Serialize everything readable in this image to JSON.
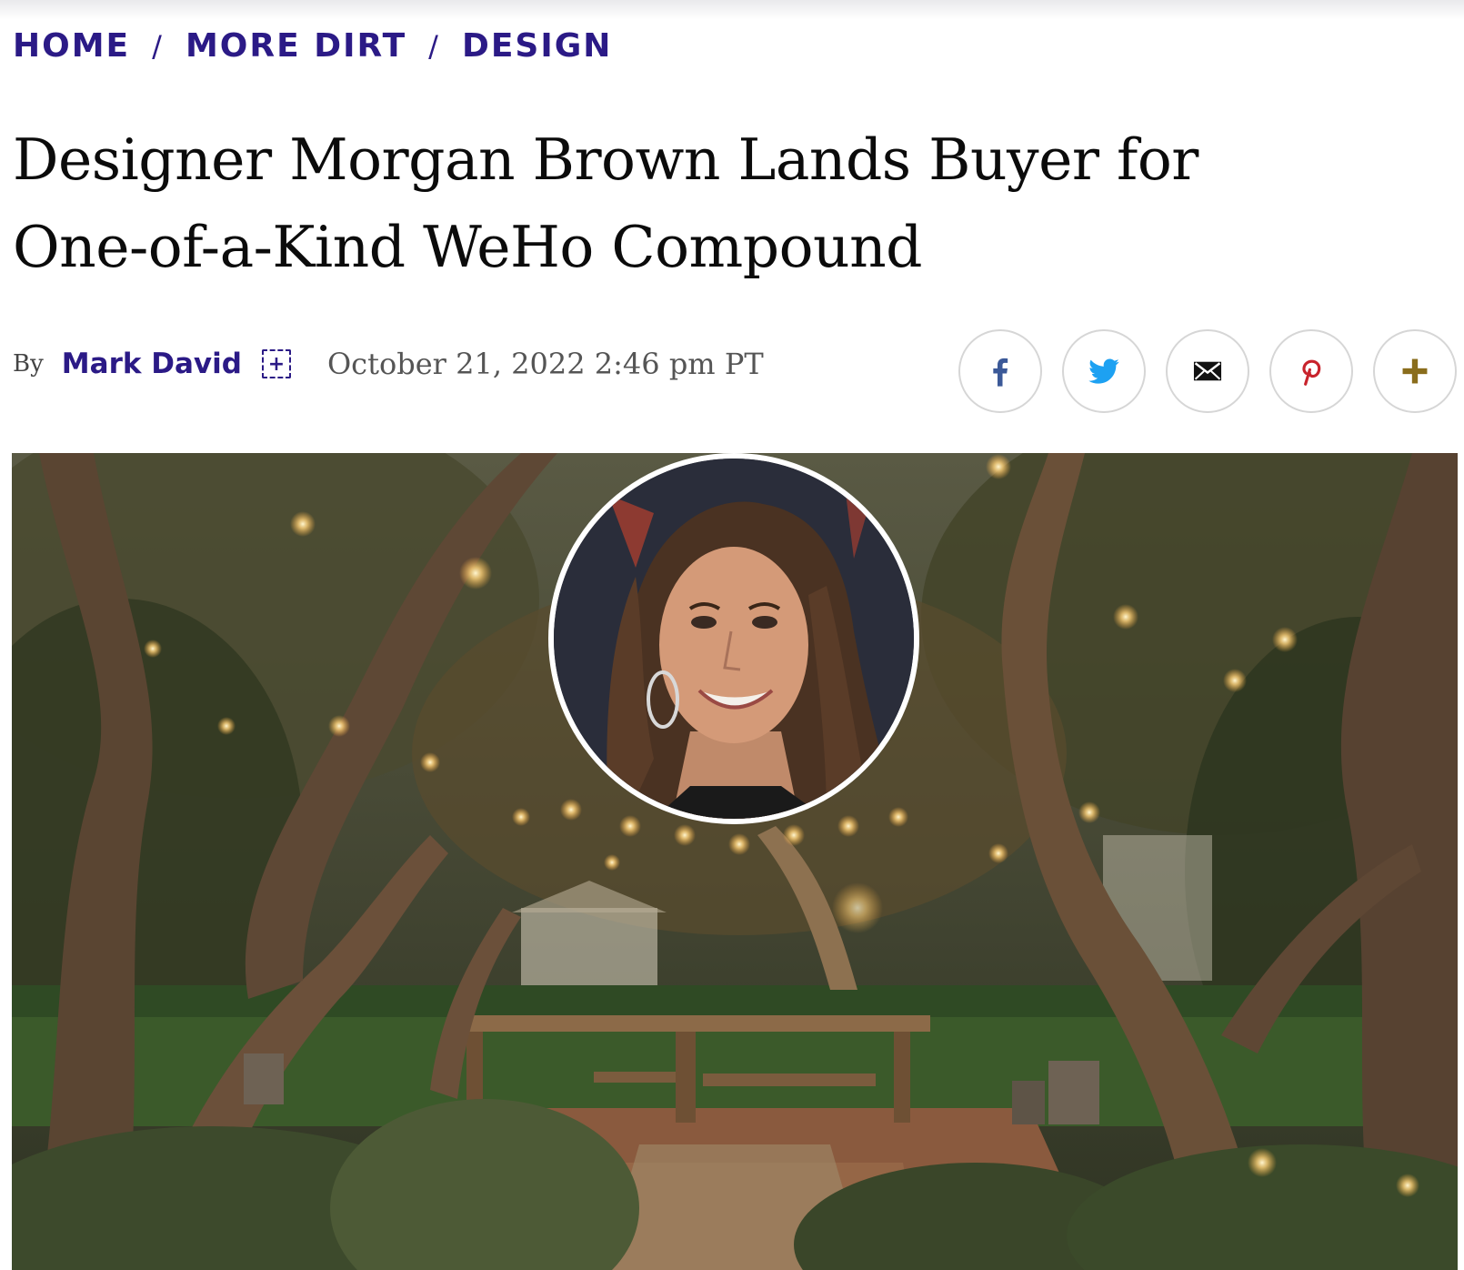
{
  "breadcrumb": {
    "items": [
      {
        "label": "HOME"
      },
      {
        "label": "MORE DIRT"
      },
      {
        "label": "DESIGN"
      }
    ],
    "separator": "/"
  },
  "article": {
    "title_line1": "Designer Morgan Brown Lands Buyer for",
    "title_line2": "One-of-a-Kind WeHo Compound",
    "by_label": "By",
    "author": "Mark David",
    "date": "October 21, 2022 2:46 pm PT"
  },
  "share": {
    "buttons": [
      {
        "icon": "facebook-icon",
        "color": "#3b5998"
      },
      {
        "icon": "twitter-icon",
        "color": "#1da1f2"
      },
      {
        "icon": "email-icon",
        "color": "#111111"
      },
      {
        "icon": "pinterest-icon",
        "color": "#c8232c"
      },
      {
        "icon": "plus-icon",
        "color": "#8a6d1c"
      }
    ]
  },
  "colors": {
    "brand": "#2b1a86",
    "text": "#0b0b0b"
  },
  "hero": {
    "description": "Outdoor garden dining area under olive trees with string lights, inset circular portrait"
  }
}
